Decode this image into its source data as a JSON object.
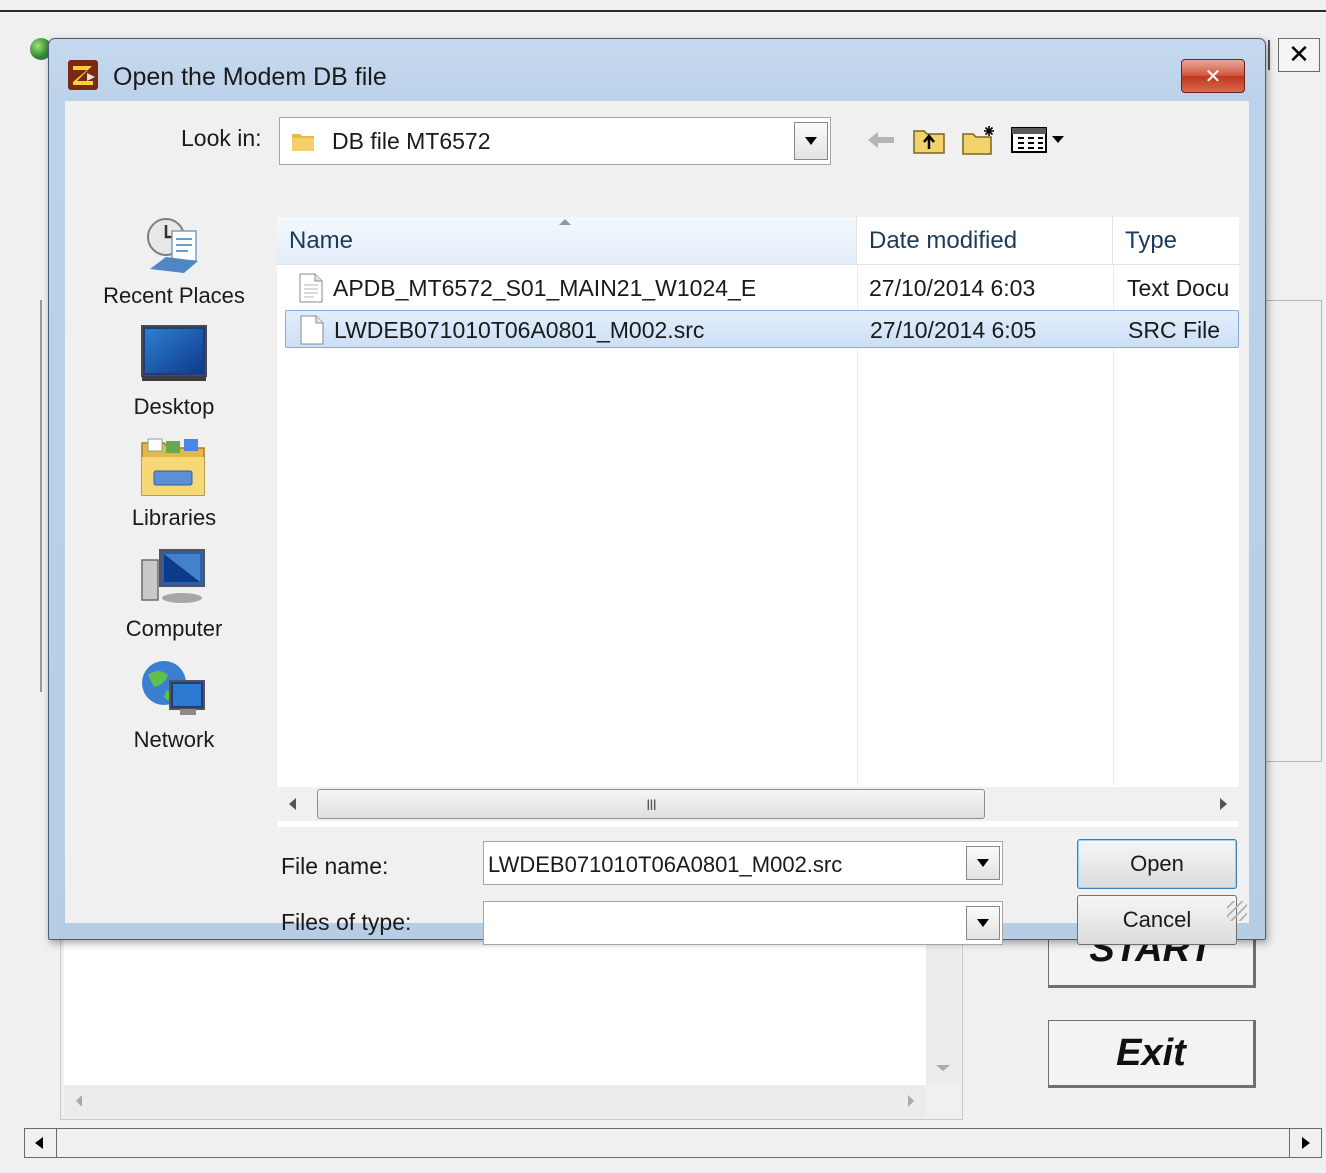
{
  "background": {
    "close_label": "✕",
    "start_label": "START",
    "exit_label": "Exit"
  },
  "dialog": {
    "title": "Open the Modem DB file",
    "close_label": "✕",
    "look_in_label": "Look in:",
    "look_in_value": "DB file MT6572",
    "places": [
      {
        "label": "Recent Places",
        "icon": "recent-places-icon"
      },
      {
        "label": "Desktop",
        "icon": "desktop-icon"
      },
      {
        "label": "Libraries",
        "icon": "libraries-icon"
      },
      {
        "label": "Computer",
        "icon": "computer-icon"
      },
      {
        "label": "Network",
        "icon": "network-icon"
      }
    ],
    "columns": {
      "name": "Name",
      "date": "Date modified",
      "type": "Type"
    },
    "files": [
      {
        "name": "APDB_MT6572_S01_MAIN21_W1024_E",
        "date": "27/10/2014 6:03",
        "type": "Text Docu",
        "selected": false
      },
      {
        "name": "LWDEB071010T06A0801_M002.src",
        "date": "27/10/2014 6:05",
        "type": "SRC File",
        "selected": true
      }
    ],
    "file_name_label": "File name:",
    "file_name_value": "LWDEB071010T06A0801_M002.src",
    "files_of_type_label": "Files of type:",
    "files_of_type_value": "",
    "open_label": "Open",
    "cancel_label": "Cancel",
    "scroll_grip": "III"
  },
  "colors": {
    "selection": "#cddff6",
    "title_close": "#c0381f",
    "header_text": "#1e3a5a"
  }
}
